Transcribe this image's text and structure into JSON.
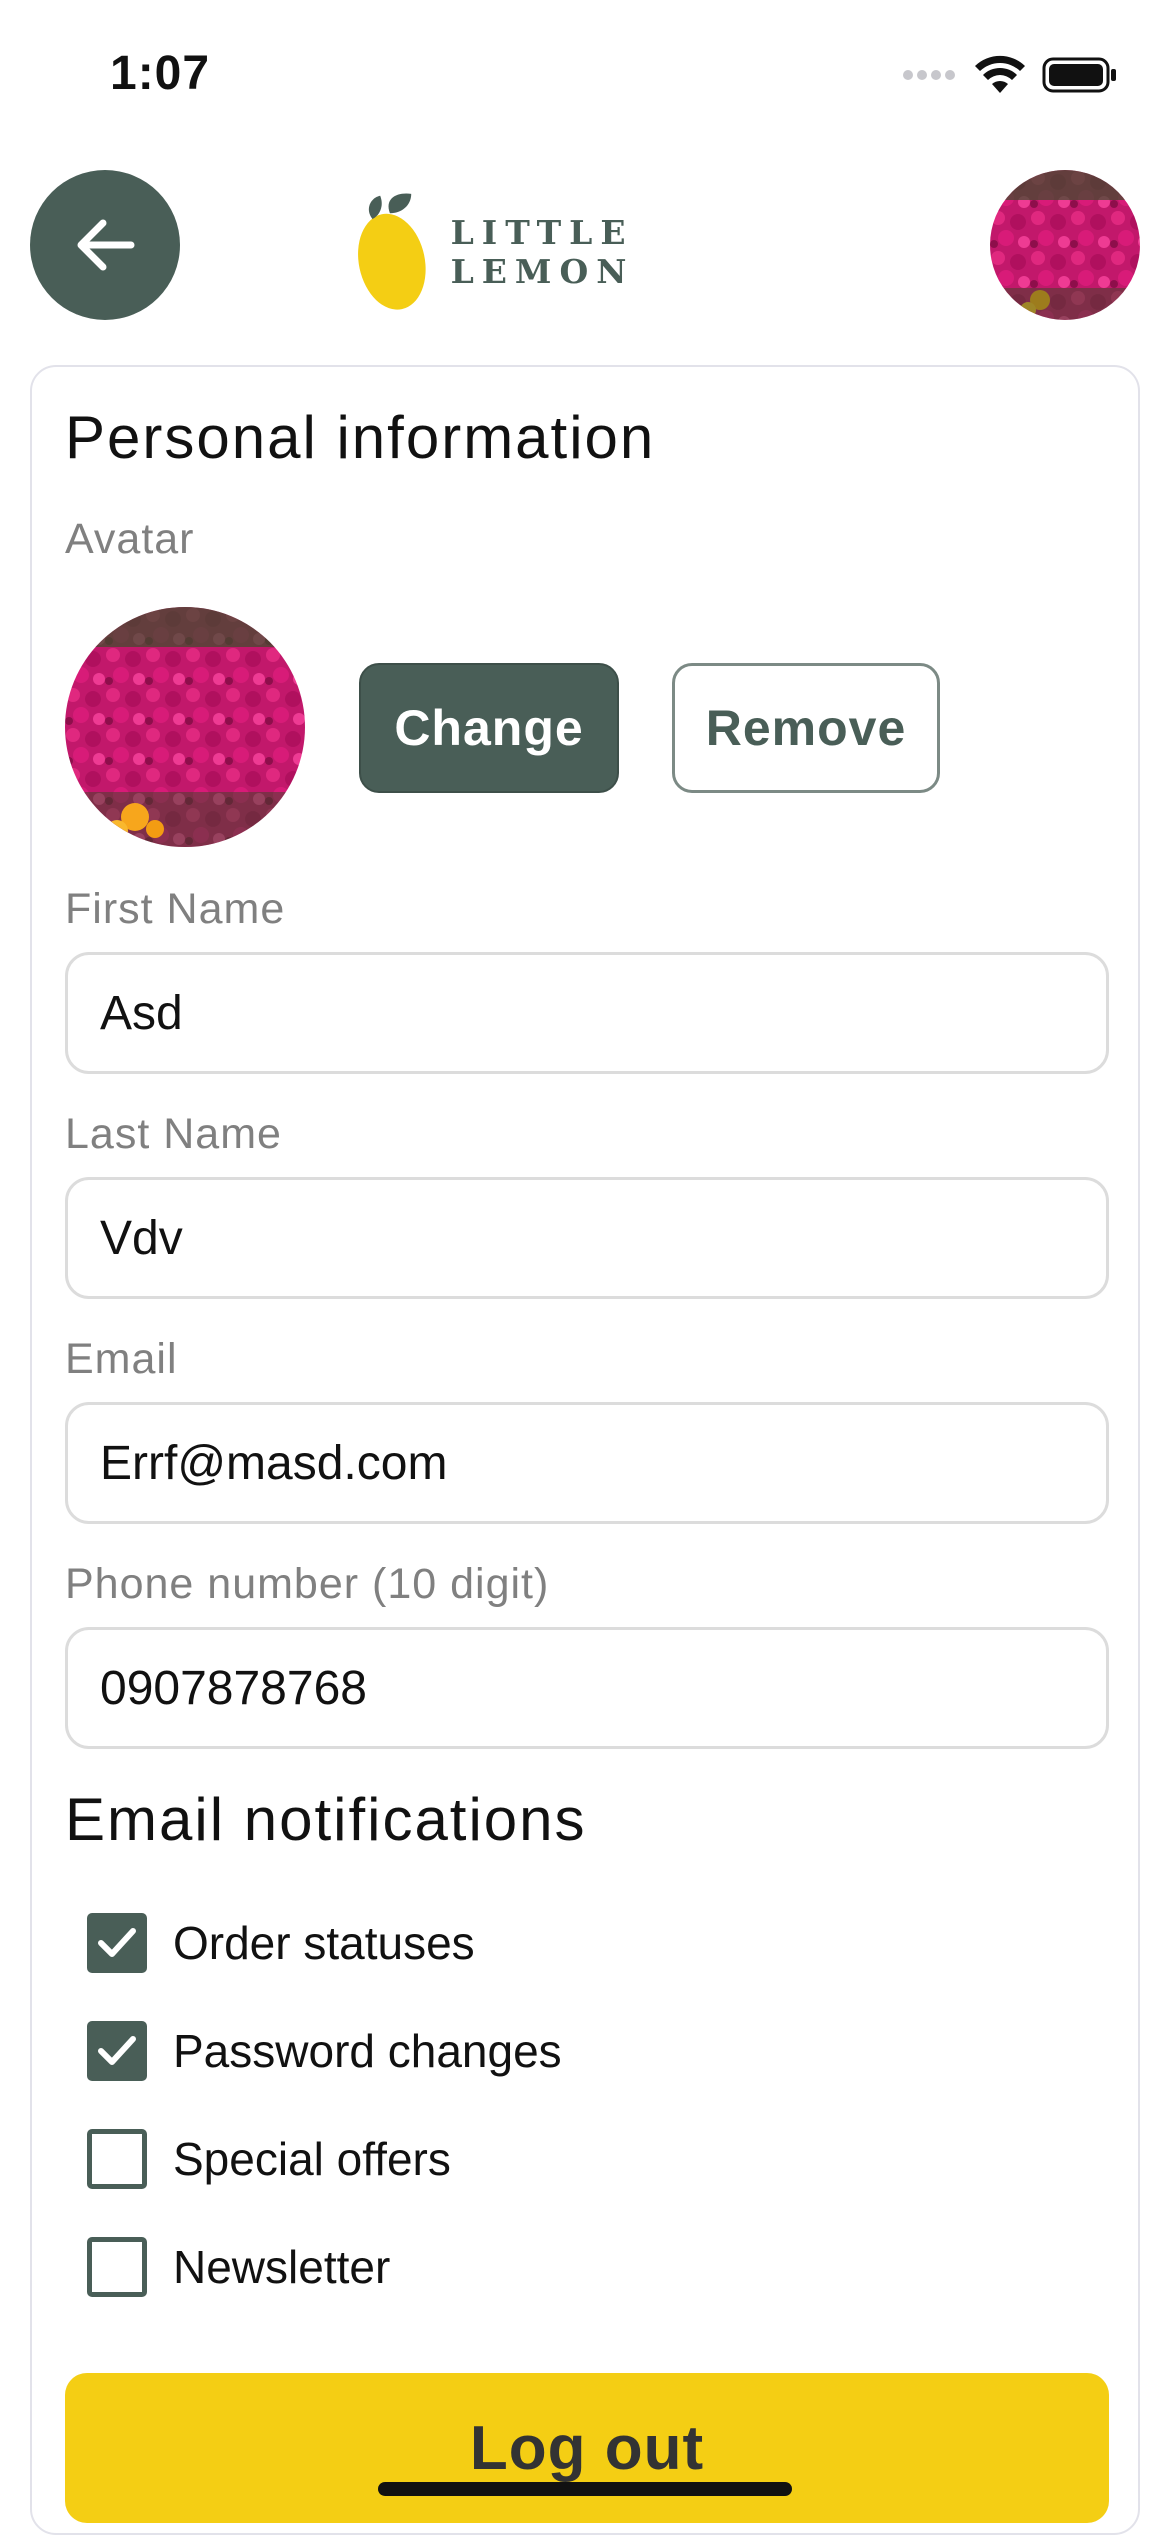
{
  "status_bar": {
    "time": "1:07"
  },
  "header": {
    "back_icon": "arrow-left-icon",
    "logo_text": "LITTLE LEMON",
    "logo_icon": "lemon-icon",
    "avatar_icon": "profile-avatar"
  },
  "personal": {
    "title": "Personal information",
    "avatar_label": "Avatar",
    "change_label": "Change",
    "remove_label": "Remove",
    "first_name_label": "First Name",
    "first_name_value": "Asd",
    "last_name_label": "Last Name",
    "last_name_value": "Vdv",
    "email_label": "Email",
    "email_value": "Errf@masd.com",
    "phone_label": "Phone number (10 digit)",
    "phone_value": "0907878768"
  },
  "notifications": {
    "title": "Email notifications",
    "items": [
      {
        "label": "Order statuses",
        "checked": true
      },
      {
        "label": "Password changes",
        "checked": true
      },
      {
        "label": "Special offers",
        "checked": false
      },
      {
        "label": "Newsletter",
        "checked": false
      }
    ]
  },
  "logout_label": "Log out",
  "colors": {
    "primary": "#495E57",
    "accent": "#F4CE14",
    "label_gray": "#808080"
  }
}
